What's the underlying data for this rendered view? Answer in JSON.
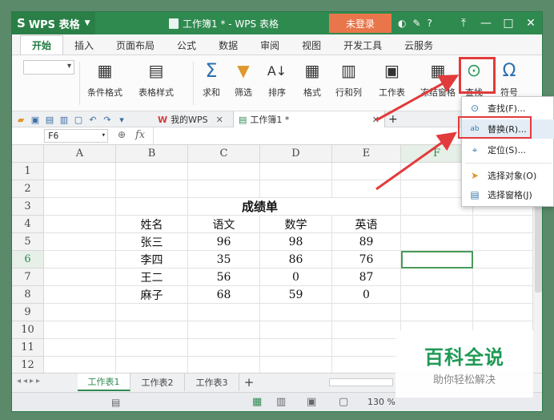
{
  "titlebar": {
    "app_name": "WPS 表格",
    "doc_title": "工作簿1 * - WPS 表格",
    "login": "未登录",
    "help": "?",
    "icons": [
      "theme-icon",
      "skin-icon",
      "help-icon"
    ]
  },
  "menu_tabs": [
    "开始",
    "插入",
    "页面布局",
    "公式",
    "数据",
    "审阅",
    "视图",
    "开发工具",
    "云服务"
  ],
  "ribbon": {
    "buttons": [
      {
        "label": "条件格式",
        "icon": "conditional-format-icon"
      },
      {
        "label": "表格样式",
        "icon": "table-style-icon"
      },
      {
        "label": "求和",
        "icon": "sum-icon"
      },
      {
        "label": "筛选",
        "icon": "filter-icon"
      },
      {
        "label": "排序",
        "icon": "sort-icon"
      },
      {
        "label": "格式",
        "icon": "format-icon"
      },
      {
        "label": "行和列",
        "icon": "row-col-icon"
      },
      {
        "label": "工作表",
        "icon": "worksheet-icon"
      },
      {
        "label": "冻结窗格",
        "icon": "freeze-icon"
      },
      {
        "label": "查找",
        "icon": "find-icon"
      },
      {
        "label": "符号",
        "icon": "symbol-icon"
      }
    ]
  },
  "doc_tabs": {
    "mywps": "我的WPS",
    "current": "工作簿1 *"
  },
  "formula_bar": {
    "name_box": "F6",
    "fx": "fx"
  },
  "columns": [
    "A",
    "B",
    "C",
    "D",
    "E",
    "F"
  ],
  "rows": [
    "1",
    "2",
    "3",
    "4",
    "5",
    "6",
    "7",
    "8",
    "9",
    "10",
    "11",
    "12"
  ],
  "sheet": {
    "title": "成绩单",
    "headers": [
      "姓名",
      "语文",
      "数学",
      "英语"
    ],
    "data": [
      [
        "张三",
        "96",
        "98",
        "89"
      ],
      [
        "李四",
        "35",
        "86",
        "76"
      ],
      [
        "王二",
        "56",
        "0",
        "87"
      ],
      [
        "麻子",
        "68",
        "59",
        "0"
      ]
    ]
  },
  "sheet_tabs": [
    "工作表1",
    "工作表2",
    "工作表3"
  ],
  "status": {
    "zoom": "130 %"
  },
  "dropdown": {
    "items": [
      {
        "label": "查找(F)...",
        "icon": "find-icon"
      },
      {
        "label": "替换(R)...",
        "icon": "replace-icon"
      },
      {
        "label": "定位(S)...",
        "icon": "locate-icon"
      },
      {
        "label": "选择对象(O)",
        "icon": "select-object-icon"
      },
      {
        "label": "选择窗格(J)",
        "icon": "selection-pane-icon"
      }
    ]
  },
  "watermark": {
    "big": "百科全说",
    "small": "助你轻松解决"
  },
  "colors": {
    "titlebar": "#2f8a4f",
    "login": "#e9764a",
    "highlight": "#e23b3b",
    "selection": "#4a9a5a"
  }
}
